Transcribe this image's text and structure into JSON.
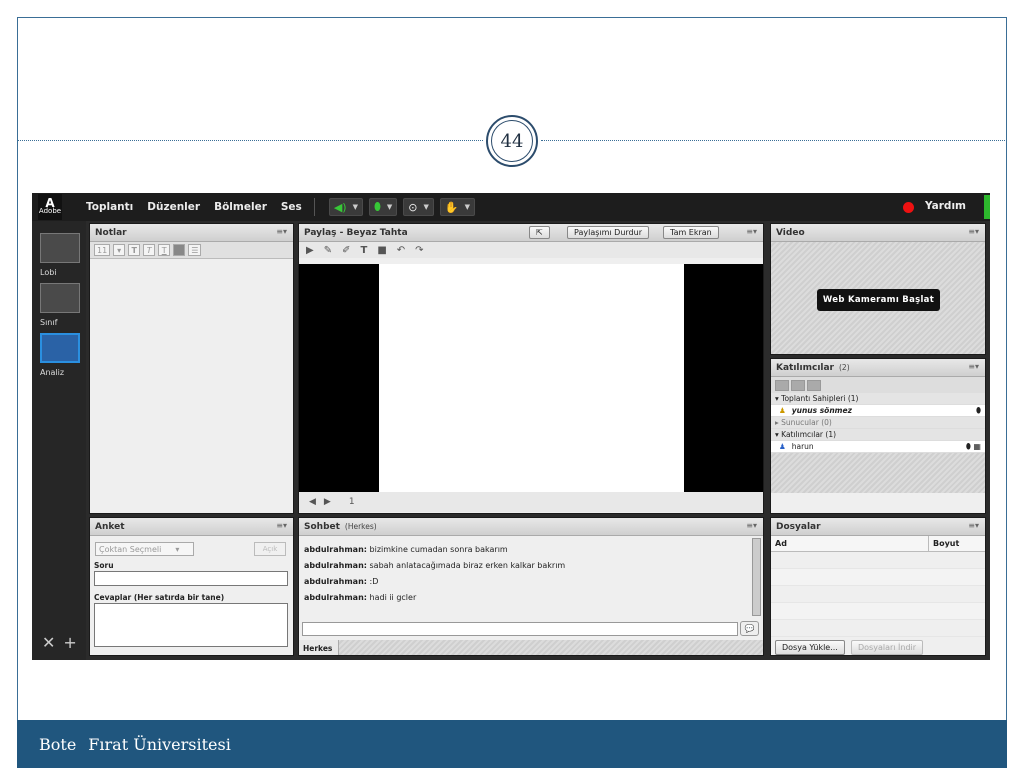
{
  "slide": {
    "number": "44",
    "footer": [
      "Bote",
      "Fırat Üniversitesi"
    ]
  },
  "app": {
    "logo_text": "Adobe",
    "menus": [
      "Toplantı",
      "Düzenler",
      "Bölmeler",
      "Ses"
    ],
    "help": "Yardım",
    "layouts": [
      {
        "label": "Lobi"
      },
      {
        "label": "Sınıf"
      },
      {
        "label": "Analiz"
      }
    ]
  },
  "notes": {
    "title": "Notlar",
    "font_size": "11"
  },
  "share": {
    "title": "Paylaş - Beyaz Tahta",
    "stop_button": "Paylaşımı Durdur",
    "fullscreen_button": "Tam Ekran",
    "page": "1"
  },
  "video": {
    "title": "Video",
    "start_button": "Web Kameramı Başlat"
  },
  "attendees": {
    "title": "Katılımcılar",
    "count": "(2)",
    "groups": [
      {
        "label": "Toplantı Sahipleri (1)",
        "users": [
          "yunus sönmez"
        ]
      },
      {
        "label": "Sunucular (0)",
        "users": []
      },
      {
        "label": "Katılımcılar (1)",
        "users": [
          "harun"
        ]
      }
    ]
  },
  "poll": {
    "title": "Anket",
    "type_select": "Çoktan Seçmeli",
    "open_button": "Açık",
    "question_label": "Soru",
    "answers_label": "Cevaplar (Her satırda bir tane)"
  },
  "chat": {
    "title": "Sohbet",
    "scope": "(Herkes)",
    "messages": [
      {
        "sender": "abdulrahman:",
        "text": "bizimkine cumadan sonra bakarım"
      },
      {
        "sender": "abdulrahman:",
        "text": "sabah anlatacağımada biraz erken kalkar bakrım"
      },
      {
        "sender": "abdulrahman:",
        "text": ":D"
      },
      {
        "sender": "abdulrahman:",
        "text": "hadi ii gcler"
      }
    ],
    "tab": "Herkes"
  },
  "files": {
    "title": "Dosyalar",
    "col_name": "Ad",
    "col_size": "Boyut",
    "upload_button": "Dosya Yükle...",
    "download_button": "Dosyaları İndir"
  }
}
